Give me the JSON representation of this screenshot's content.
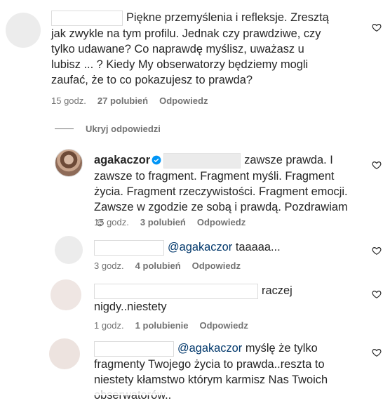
{
  "ui": {
    "reply_label": "Odpowiedz",
    "hide_replies": "Ukryj odpowiedzi",
    "accent_link": "#00376b",
    "meta_color": "#737373",
    "verified_color": "#0095f6"
  },
  "comments": [
    {
      "text": "Piękne przemyślenia i refleksje. Zresztą jak zwykle na tym profilu. Jednak czy prawdziwe, czy tylko udawane? Co naprawdę myślisz, uważasz u lubisz ... ? Kiedy My obserwatorzy będziemy mogli zaufać, że to co pokazujesz to prawda?",
      "time": "15 godz.",
      "likes": "27 polubień"
    },
    {
      "username": "agakaczor",
      "text": "zawsze prawda. I zawsze to fragment. Fragment myśli. Fragment życia. Fragment rzeczywistości. Fragment emocji. Zawsze w zgodzie ze sobą i prawdą. Pozdrawiam ☺",
      "time": "15 godz.",
      "likes": "3 polubień"
    },
    {
      "mention": "@agakaczor",
      "text": "taaaaa...",
      "time": "3 godz.",
      "likes": "4 polubień"
    },
    {
      "text": "raczej nigdy..niestety",
      "time": "1 godz.",
      "likes": "1 polubienie"
    },
    {
      "mention": "@agakaczor",
      "text": "myślę że tylko fragmenty Twojego życia to prawda..reszta to niestety kłamstwo którym karmisz Nas Twoich obserwatorów.."
    }
  ]
}
